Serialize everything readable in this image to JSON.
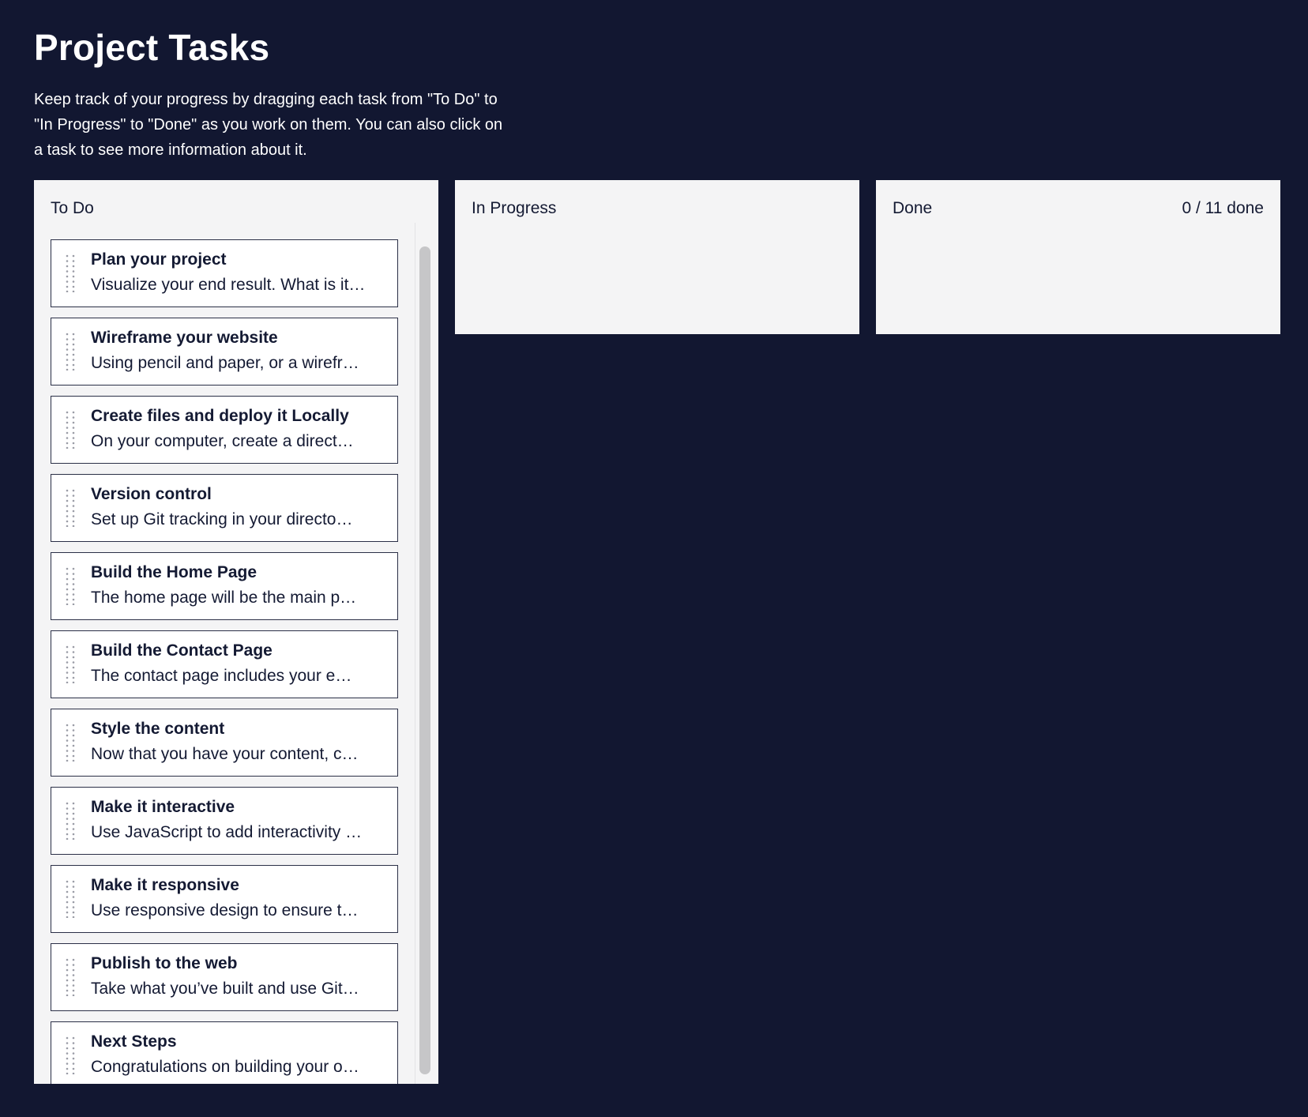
{
  "page": {
    "title": "Project Tasks",
    "description": "Keep track of your progress by dragging each task from \"To Do\" to \"In Progress\" to \"Done\" as you work on them. You can also click on a task to see more information about it."
  },
  "columns": {
    "todo": {
      "label": "To Do"
    },
    "in_progress": {
      "label": "In Progress"
    },
    "done": {
      "label": "Done",
      "counter": "0 / 11 done"
    }
  },
  "tasks": [
    {
      "title": "Plan your project",
      "summary": "Visualize your end result. What is it…"
    },
    {
      "title": "Wireframe your website",
      "summary": "Using pencil and paper, or a wirefr…"
    },
    {
      "title": "Create files and deploy it Locally",
      "summary": "On your computer, create a direct…"
    },
    {
      "title": "Version control",
      "summary": "Set up Git tracking in your directo…"
    },
    {
      "title": "Build the Home Page",
      "summary": "The home page will be the main p…"
    },
    {
      "title": "Build the Contact Page",
      "summary": "The contact page includes your e…"
    },
    {
      "title": "Style the content",
      "summary": "Now that you have your content, c…"
    },
    {
      "title": "Make it interactive",
      "summary": "Use JavaScript to add interactivity …"
    },
    {
      "title": "Make it responsive",
      "summary": "Use responsive design to ensure t…"
    },
    {
      "title": "Publish to the web",
      "summary": "Take what you’ve built and use Git…"
    },
    {
      "title": "Next Steps",
      "summary": "Congratulations on building your o…"
    }
  ],
  "icons": {
    "drag_handle": "drag-handle-icon"
  },
  "colors": {
    "background": "#121731",
    "column": "#f4f4f5",
    "card": "#ffffff",
    "text_dark": "#141a33",
    "scrollbar": "#c6c6c8"
  }
}
